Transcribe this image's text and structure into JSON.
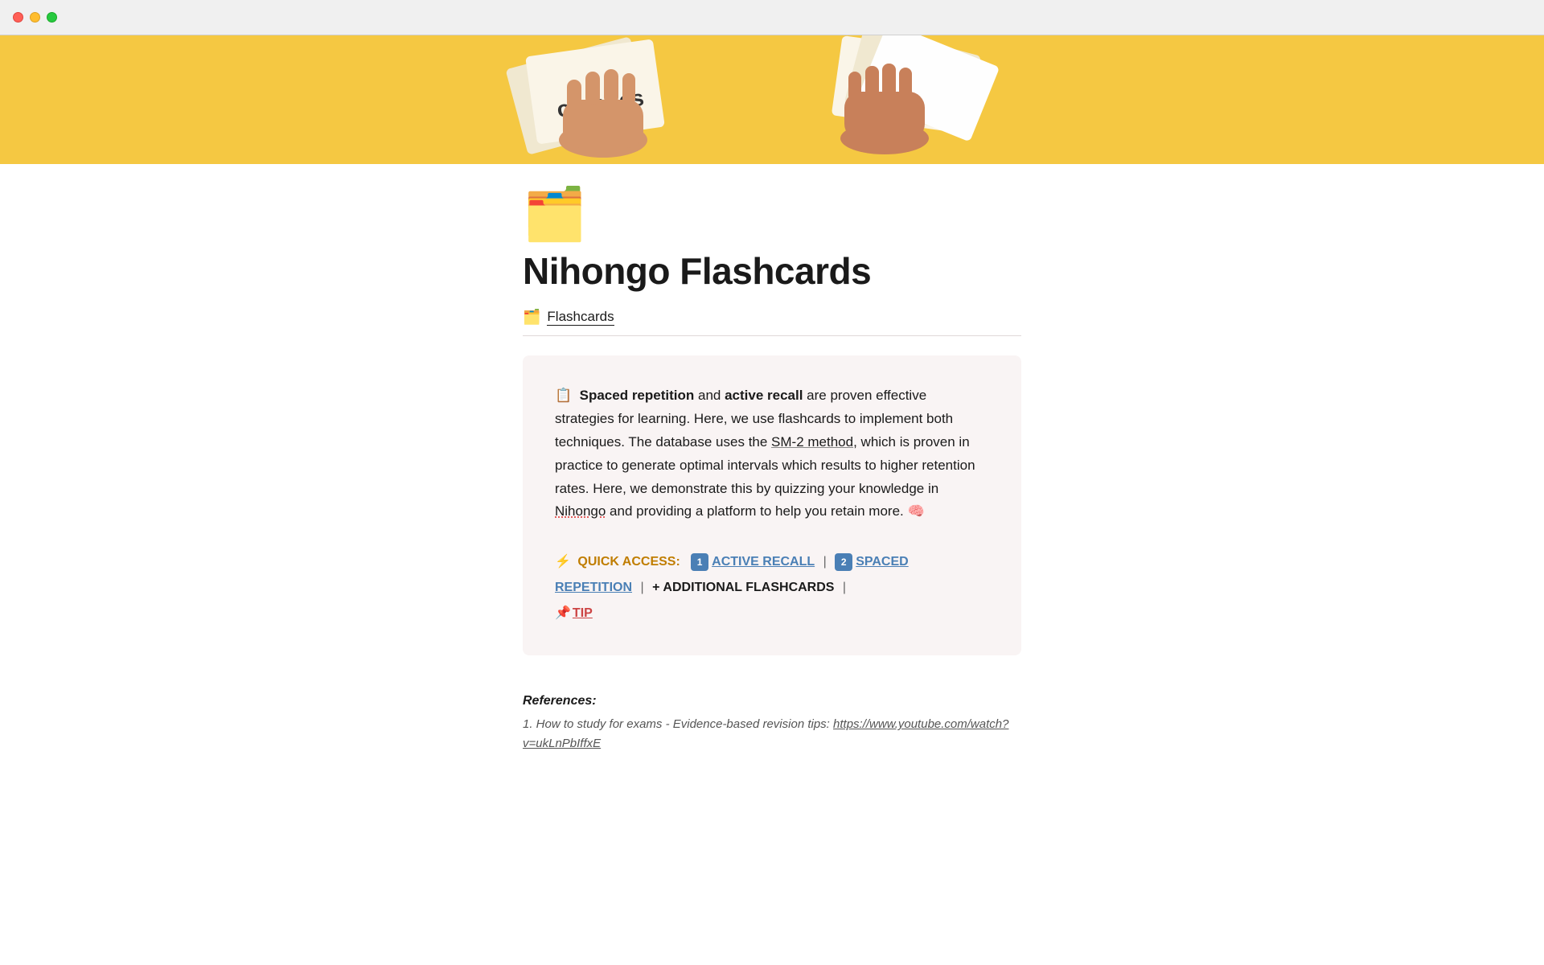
{
  "titlebar": {
    "traffic_lights": [
      "close",
      "minimize",
      "maximize"
    ]
  },
  "hero": {
    "background_color": "#f5c842",
    "alt_text": "Hands holding flashcards on yellow background"
  },
  "page": {
    "icon": "🗂️",
    "title": "Nihongo Flashcards",
    "breadcrumb_icon": "🗂️",
    "breadcrumb_label": "Flashcards"
  },
  "info_card": {
    "intro_icon": "📋",
    "paragraph": "Spaced repetition and active recall are proven effective strategies for learning. Here, we use flashcards to implement both techniques. The database uses the SM-2 method, which is proven in practice to generate optimal intervals which results to higher retention rates. Here, we demonstrate this by quizzing your knowledge in Nihongo and providing a platform to help you retain more. 🧠",
    "sm2_link_text": "SM-2 method",
    "sm2_link_url": "#sm2"
  },
  "quick_access": {
    "lightning_emoji": "⚡",
    "label": "QUICK ACCESS:",
    "item1_badge": "1",
    "item1_label": "ACTIVE RECALL",
    "separator1": "|",
    "item2_badge": "2",
    "item2_label": "SPACED REPETITION",
    "separator2": "|",
    "item3_plus": "+",
    "item3_label": "ADDITIONAL FLASHCARDS",
    "separator3": "|",
    "pin_emoji": "📌",
    "item4_label": "TIP"
  },
  "references": {
    "title": "References:",
    "item1_text": "1. How to study for exams - Evidence-based revision tips:",
    "item1_url": "https://www.youtube.com/watch?v=ukLnPbIffxE"
  }
}
